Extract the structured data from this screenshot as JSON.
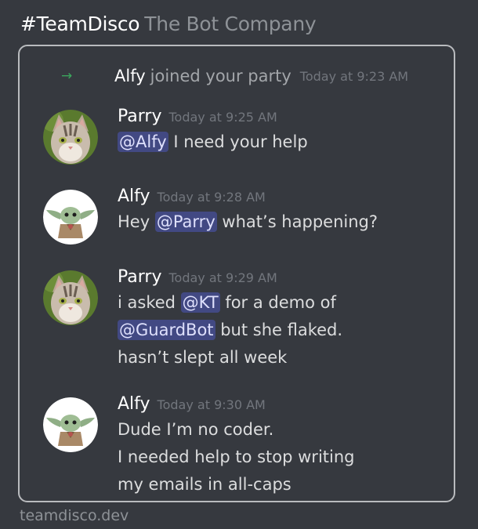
{
  "header": {
    "channel": "#TeamDisco",
    "subtitle": "The Bot Company"
  },
  "system_message": {
    "arrow_icon": "arrow-right-icon",
    "user": "Alfy",
    "text": "joined your party",
    "time": "Today at 9:23 AM"
  },
  "messages": [
    {
      "author": "Parry",
      "time": "Today at 9:25 AM",
      "avatar": "cat-avatar",
      "lines": [
        {
          "mention": "@Alfy",
          "text": " I need your help"
        }
      ]
    },
    {
      "author": "Alfy",
      "time": "Today at 9:28 AM",
      "avatar": "baby-yoda-avatar",
      "lines": [
        {
          "before": "Hey ",
          "mention": "@Parry",
          "text": " what’s happening?"
        }
      ]
    },
    {
      "author": "Parry",
      "time": "Today at 9:29 AM",
      "avatar": "cat-avatar",
      "lines": [
        {
          "before": "i asked ",
          "mention": "@KT",
          "text": " for a demo of"
        },
        {
          "mention": "@GuardBot",
          "text": " but she flaked."
        },
        {
          "text": "hasn’t slept all week"
        }
      ]
    },
    {
      "author": "Alfy",
      "time": "Today at 9:30 AM",
      "avatar": "baby-yoda-avatar",
      "lines": [
        {
          "text": "Dude I’m no coder."
        },
        {
          "text": "I needed help to stop writing"
        },
        {
          "text": "my emails in all-caps"
        }
      ]
    }
  ],
  "footer": {
    "text": "teamdisco.dev"
  },
  "colors": {
    "background": "#36393f",
    "mention_bg": "#4e5488",
    "join_arrow": "#3ba55c",
    "timestamp": "#72767d"
  }
}
